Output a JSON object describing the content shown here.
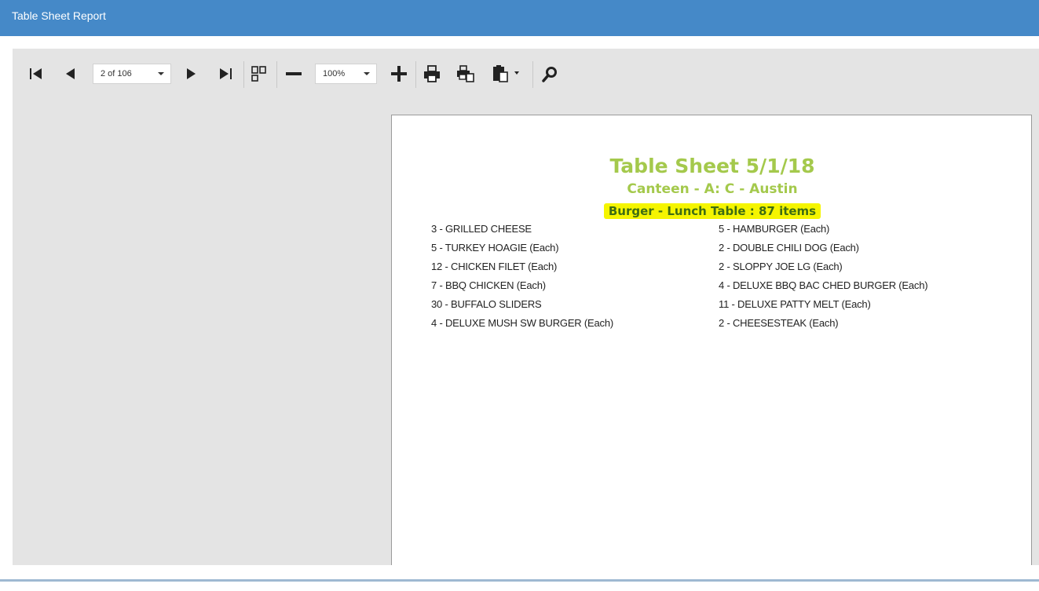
{
  "window": {
    "title": "Table Sheet Report"
  },
  "toolbar": {
    "page_select": {
      "value": "2 of 106"
    },
    "zoom_select": {
      "value": "100%"
    },
    "icons": [
      "first-page-icon",
      "prev-page-icon",
      "next-page-icon",
      "last-page-icon",
      "multi-page-icon",
      "zoom-out-icon",
      "zoom-in-icon",
      "print-icon",
      "print-page-icon",
      "export-icon",
      "search-icon"
    ]
  },
  "report": {
    "title": "Table Sheet  5/1/18",
    "subtitle": "Canteen - A: C - Austin",
    "section": "Burger - Lunch Table : 87 items",
    "highlight_color": "#f5f500",
    "title_color": "#a4c94c",
    "items_left": [
      "3 - GRILLED CHEESE",
      "5 - TURKEY HOAGIE (Each)",
      "12 - CHICKEN FILET (Each)",
      "7 - BBQ CHICKEN (Each)",
      "30 - BUFFALO SLIDERS",
      "4 - DELUXE MUSH SW BURGER (Each)"
    ],
    "items_right": [
      "5 - HAMBURGER (Each)",
      "2 - DOUBLE CHILI DOG (Each)",
      "2 - SLOPPY JOE LG (Each)",
      "4 - DELUXE BBQ BAC CHED BURGER (Each)",
      "11 - DELUXE PATTY MELT (Each)",
      "2 - CHEESESTEAK (Each)"
    ]
  },
  "colors": {
    "header_bg": "#4589c8",
    "viewer_bg": "#e4e4e4"
  }
}
